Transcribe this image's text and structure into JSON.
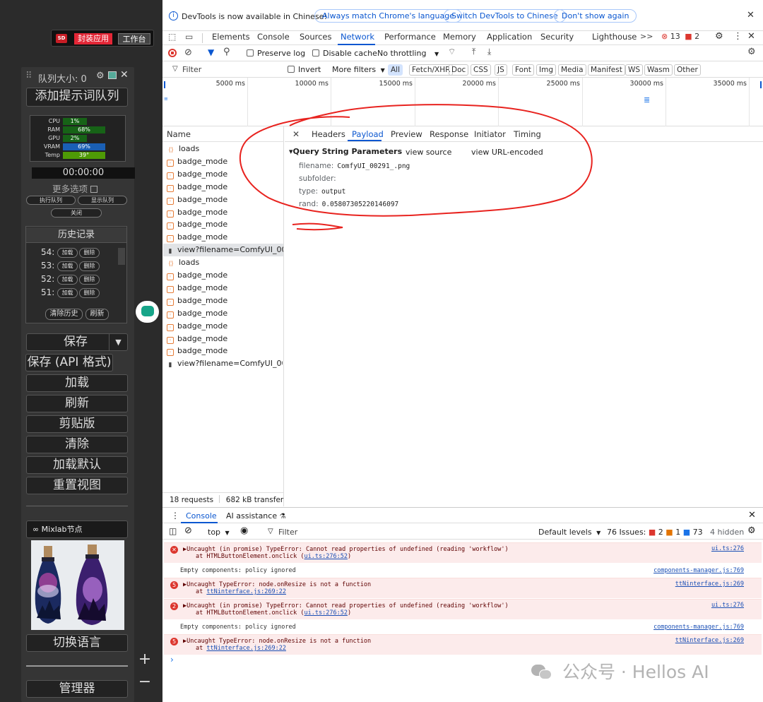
{
  "comfy": {
    "sd_badge": "SD",
    "pack_app": "封装应用",
    "workbench": "工作台",
    "queue_size": "队列大小: 0",
    "add_prompt_queue": "添加提示词队列",
    "stats": [
      {
        "label": "CPU",
        "value": "1%",
        "fraction": 0.01,
        "color": "#176317"
      },
      {
        "label": "RAM",
        "value": "68%",
        "fraction": 0.68,
        "color": "#176317"
      },
      {
        "label": "GPU",
        "value": "2%",
        "fraction": 0.02,
        "color": "#176317"
      },
      {
        "label": "VRAM",
        "value": "69%",
        "fraction": 0.69,
        "color": "#1a5fb4"
      },
      {
        "label": "Temp",
        "value": "39°",
        "fraction": 0.39,
        "color": "#4e9a06"
      }
    ],
    "timer": "00:00:00",
    "more_options": "更多选项",
    "exec_queue": "执行队列",
    "show_queue": "显示队列",
    "close": "关闭",
    "history_title": "历史记录",
    "history": [
      {
        "num": "54:",
        "load": "加载",
        "del": "删除"
      },
      {
        "num": "53:",
        "load": "加载",
        "del": "删除"
      },
      {
        "num": "52:",
        "load": "加载",
        "del": "删除"
      },
      {
        "num": "51:",
        "load": "加载",
        "del": "删除"
      }
    ],
    "clear_history": "清除历史",
    "refresh_small": "刷新",
    "save": "保存",
    "save_api": "保存 (API 格式)",
    "load": "加载",
    "refresh": "刷新",
    "clipboard": "剪贴版",
    "clear": "清除",
    "load_default": "加载默认",
    "reset_view": "重置视图",
    "mixlab": "Mixlab节点",
    "switch_lang": "切换语言",
    "manager": "管理器",
    "plus": "+",
    "minus": "−"
  },
  "devtools": {
    "infobar_text": "DevTools is now available in Chinese!",
    "btn_match": "Always match Chrome's language",
    "btn_switch": "Switch DevTools to Chinese",
    "btn_dont": "Don't show again",
    "tabs": [
      "Elements",
      "Console",
      "Sources",
      "Network",
      "Performance",
      "Memory",
      "Application",
      "Security",
      "Lighthouse"
    ],
    "more_tabs": ">>",
    "errors_count": "13",
    "warnings_count": "2",
    "preserve_log": "Preserve log",
    "disable_cache": "Disable cache",
    "throttling": "No throttling",
    "filter_placeholder": "Filter",
    "invert": "Invert",
    "more_filters": "More filters",
    "filter_types": [
      "All",
      "Fetch/XHR",
      "Doc",
      "CSS",
      "JS",
      "Font",
      "Img",
      "Media",
      "Manifest",
      "WS",
      "Wasm",
      "Other"
    ],
    "timeline_ticks": [
      "5000 ms",
      "10000 ms",
      "15000 ms",
      "20000 ms",
      "25000 ms",
      "30000 ms",
      "35000 ms"
    ],
    "name_header": "Name",
    "requests": [
      {
        "type": "js",
        "name": "loads"
      },
      {
        "type": "fetch",
        "name": "badge_mode"
      },
      {
        "type": "fetch",
        "name": "badge_mode"
      },
      {
        "type": "fetch",
        "name": "badge_mode"
      },
      {
        "type": "fetch",
        "name": "badge_mode"
      },
      {
        "type": "fetch",
        "name": "badge_mode"
      },
      {
        "type": "fetch",
        "name": "badge_mode"
      },
      {
        "type": "fetch",
        "name": "badge_mode"
      },
      {
        "type": "img",
        "name": "view?filename=ComfyUI_00..."
      },
      {
        "type": "js",
        "name": "loads"
      },
      {
        "type": "fetch",
        "name": "badge_mode"
      },
      {
        "type": "fetch",
        "name": "badge_mode"
      },
      {
        "type": "fetch",
        "name": "badge_mode"
      },
      {
        "type": "fetch",
        "name": "badge_mode"
      },
      {
        "type": "fetch",
        "name": "badge_mode"
      },
      {
        "type": "fetch",
        "name": "badge_mode"
      },
      {
        "type": "fetch",
        "name": "badge_mode"
      },
      {
        "type": "img",
        "name": "view?filename=ComfyUI_00..."
      }
    ],
    "summary_requests": "18 requests",
    "summary_transferred": "682 kB transferred",
    "payload_tabs": [
      "Headers",
      "Payload",
      "Preview",
      "Response",
      "Initiator",
      "Timing"
    ],
    "qsp_title": "▾Query String Parameters",
    "view_source": "view source",
    "view_url_encoded": "view URL-encoded",
    "params": [
      {
        "key": "filename:",
        "value": "ComfyUI_00291_.png"
      },
      {
        "key": "subfolder:",
        "value": ""
      },
      {
        "key": "type:",
        "value": "output"
      },
      {
        "key": "rand:",
        "value": "0.05807305220146097"
      }
    ],
    "drawer_tabs": [
      "Console",
      "AI assistance"
    ],
    "context": "top",
    "console_filter": "Filter",
    "default_levels": "Default levels",
    "issues_label": "76 Issues:",
    "issue_counts": [
      "2",
      "1",
      "73"
    ],
    "hidden": "4 hidden",
    "console_rows": [
      {
        "kind": "error",
        "badge": "",
        "line1": "▶Uncaught (in promise) TypeError: Cannot read properties of undefined (reading 'workflow')",
        "line2_pre": "at HTMLButtonElement.onclick (",
        "line2_link": "ui.ts:276:52",
        "line2_post": ")",
        "source": "ui.ts:276"
      },
      {
        "kind": "info",
        "line1": "Empty components: policy ignored",
        "source": "components-manager.js:769"
      },
      {
        "kind": "error",
        "badge": "5",
        "line1": "▶Uncaught TypeError: node.onResize is not a function",
        "line2_pre": "at ",
        "line2_link": "ttNinterface.js:269:22",
        "line2_post": "",
        "source": "ttNinterface.js:269"
      },
      {
        "kind": "error",
        "badge": "2",
        "line1": "▶Uncaught (in promise) TypeError: Cannot read properties of undefined (reading 'workflow')",
        "line2_pre": "at HTMLButtonElement.onclick (",
        "line2_link": "ui.ts:276:52",
        "line2_post": ")",
        "source": "ui.ts:276"
      },
      {
        "kind": "info",
        "line1": "Empty components: policy ignored",
        "source": "components-manager.js:769"
      },
      {
        "kind": "error",
        "badge": "5",
        "line1": "▶Uncaught TypeError: node.onResize is not a function",
        "line2_pre": "at ",
        "line2_link": "ttNinterface.js:269:22",
        "line2_post": "",
        "source": "ttNinterface.js:269"
      }
    ],
    "prompt": "›"
  },
  "watermark": "公众号 · Hellos AI",
  "colors": {
    "accent": "#0b57d0",
    "annotation": "#e8231f",
    "error_bg": "#fcebeb"
  }
}
